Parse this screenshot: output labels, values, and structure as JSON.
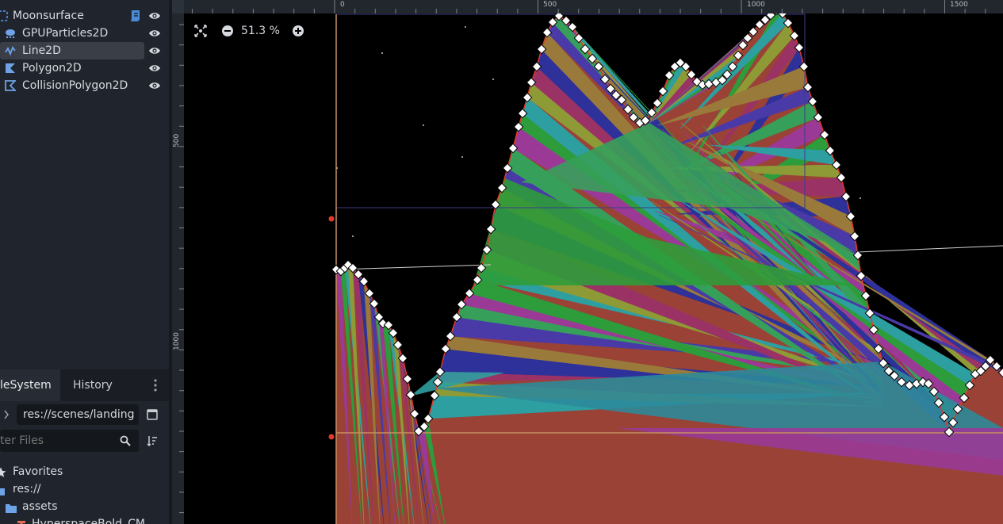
{
  "scene_tree": {
    "nodes": [
      {
        "label": "Moonsurface",
        "icon": "node2d-icon",
        "has_script": true
      },
      {
        "label": "GPUParticles2D",
        "icon": "gpu-particles-icon",
        "has_script": false
      },
      {
        "label": "Line2D",
        "icon": "line2d-icon",
        "has_script": false,
        "selected": true
      },
      {
        "label": "Polygon2D",
        "icon": "polygon2d-icon",
        "has_script": false
      },
      {
        "label": "CollisionPolygon2D",
        "icon": "collision-polygon-icon",
        "has_script": false
      }
    ]
  },
  "filesystem": {
    "tab_filesystem": "leSystem",
    "tab_history": "History",
    "path": "res://scenes/landing",
    "filter_placeholder": "ter Files",
    "items": [
      {
        "label": "Favorites",
        "icon": "star-icon"
      },
      {
        "label": "res://",
        "icon": "folder-icon"
      },
      {
        "label": "assets",
        "icon": "folder-icon"
      },
      {
        "label": "HyperspaceBold_CM",
        "icon": "font-file-icon"
      }
    ]
  },
  "viewport": {
    "zoom_level": "51.3 %",
    "hruler_labels": [
      "0",
      "500",
      "1000",
      "1500"
    ],
    "vruler_labels": [
      "500",
      "1000"
    ]
  },
  "colors": {
    "accent": "#4b8bd8",
    "selection_outline": "#e0a060",
    "polygon_outline": "#e03a2a"
  }
}
